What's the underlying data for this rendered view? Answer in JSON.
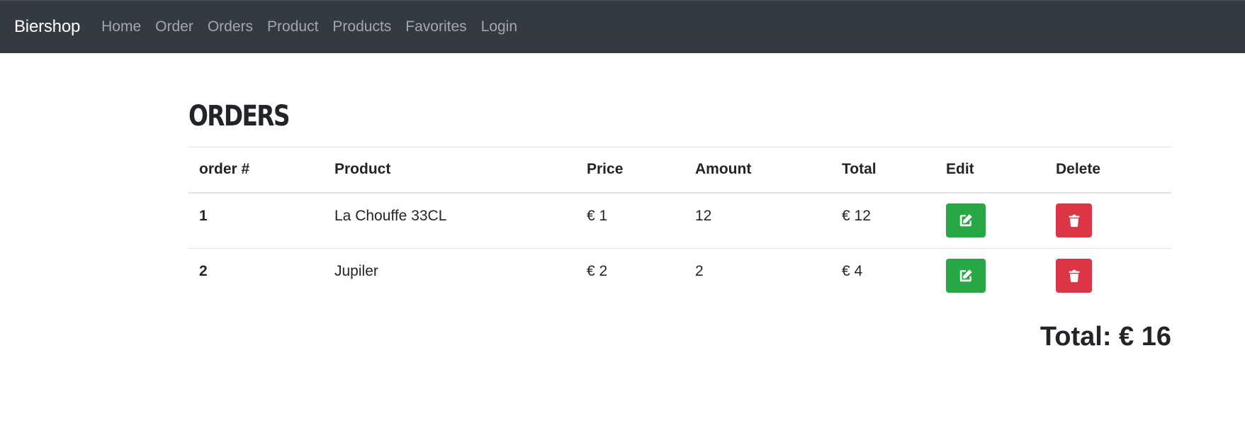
{
  "navbar": {
    "brand": "Biershop",
    "links": [
      "Home",
      "Order",
      "Orders",
      "Product",
      "Products",
      "Favorites",
      "Login"
    ]
  },
  "page": {
    "title": "Orders"
  },
  "table": {
    "headers": [
      "order #",
      "Product",
      "Price",
      "Amount",
      "Total",
      "Edit",
      "Delete"
    ],
    "rows": [
      {
        "order": "1",
        "product": "La Chouffe 33CL",
        "price": "€ 1",
        "amount": "12",
        "total": "€ 12",
        "edit_icon": "edit-icon",
        "delete_icon": "trash-icon"
      },
      {
        "order": "2",
        "product": "Jupiler",
        "price": "€ 2",
        "amount": "2",
        "total": "€ 4",
        "edit_icon": "edit-icon",
        "delete_icon": "trash-icon"
      }
    ]
  },
  "summary": {
    "total_label": "Total: € 16"
  },
  "colors": {
    "navbar_bg": "#343a40",
    "edit_button": "#28a745",
    "delete_button": "#dc3545"
  }
}
